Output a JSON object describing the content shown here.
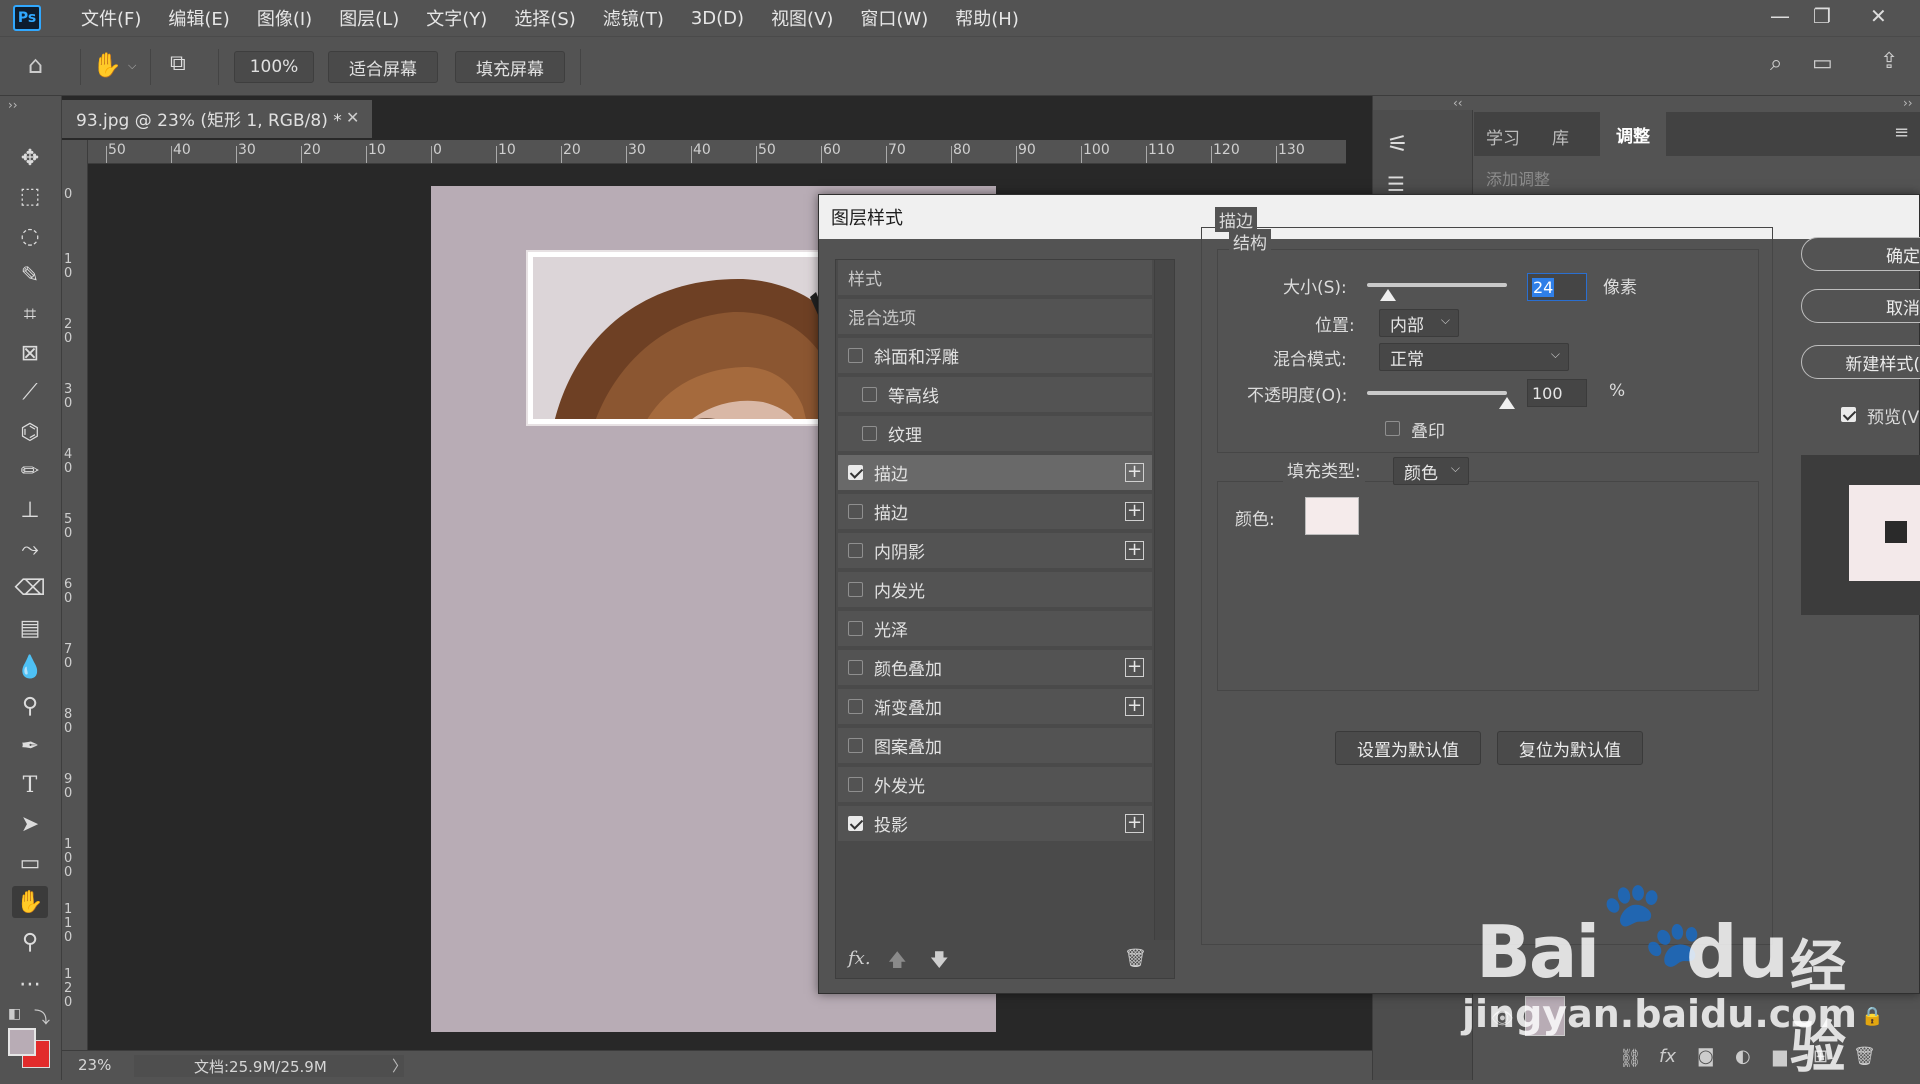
{
  "app": {
    "logo": "Ps"
  },
  "menu": [
    "文件(F)",
    "编辑(E)",
    "图像(I)",
    "图层(L)",
    "文字(Y)",
    "选择(S)",
    "滤镜(T)",
    "3D(D)",
    "视图(V)",
    "窗口(W)",
    "帮助(H)"
  ],
  "options": {
    "zoom": "100%",
    "fit_screen": "适合屏幕",
    "fill_screen": "填充屏幕"
  },
  "document": {
    "tab_title": "93.jpg @ 23% (矩形 1, RGB/8) *",
    "ruler_top": [
      "50",
      "40",
      "30",
      "20",
      "10",
      "0",
      "10",
      "20",
      "30",
      "40",
      "50",
      "60",
      "70",
      "80",
      "90",
      "100",
      "110",
      "120",
      "130"
    ],
    "ruler_left": [
      "0",
      "1 0",
      "2 0",
      "3 0",
      "4 0",
      "5 0",
      "6 0",
      "7 0",
      "8 0",
      "9 0",
      "1 0 0",
      "1 1 0",
      "1 2 0"
    ],
    "zoom": "23%",
    "doc_info": "文档:25.9M/25.9M"
  },
  "right_panel": {
    "tabs": [
      "学习",
      "库",
      "调整"
    ],
    "hint": "添加调整"
  },
  "dialog": {
    "title": "图层样式",
    "styles_header": "样式",
    "blend_options": "混合选项",
    "items": [
      {
        "label": "斜面和浮雕",
        "checked": false,
        "plus": false,
        "indent": false
      },
      {
        "label": "等高线",
        "checked": false,
        "plus": false,
        "indent": true
      },
      {
        "label": "纹理",
        "checked": false,
        "plus": false,
        "indent": true
      },
      {
        "label": "描边",
        "checked": true,
        "plus": true,
        "indent": false,
        "selected": true
      },
      {
        "label": "描边",
        "checked": false,
        "plus": true,
        "indent": false
      },
      {
        "label": "内阴影",
        "checked": false,
        "plus": true,
        "indent": false
      },
      {
        "label": "内发光",
        "checked": false,
        "plus": false,
        "indent": false
      },
      {
        "label": "光泽",
        "checked": false,
        "plus": false,
        "indent": false
      },
      {
        "label": "颜色叠加",
        "checked": false,
        "plus": true,
        "indent": false
      },
      {
        "label": "渐变叠加",
        "checked": false,
        "plus": true,
        "indent": false
      },
      {
        "label": "图案叠加",
        "checked": false,
        "plus": false,
        "indent": false
      },
      {
        "label": "外发光",
        "checked": false,
        "plus": false,
        "indent": false
      },
      {
        "label": "投影",
        "checked": true,
        "plus": true,
        "indent": false
      }
    ],
    "fx_label": "fx.",
    "stroke": {
      "section": "描边",
      "structure": "结构",
      "size_label": "大小(S):",
      "size_value": "24",
      "size_level": 0.15,
      "size_unit": "像素",
      "position_label": "位置:",
      "position_value": "内部",
      "blend_label": "混合模式:",
      "blend_value": "正常",
      "opacity_label": "不透明度(O):",
      "opacity_value": "100",
      "opacity_level": 1.0,
      "opacity_unit": "%",
      "overprint_label": "叠印",
      "fill_type_label": "填充类型:",
      "fill_type_value": "颜色",
      "color_label": "颜色:",
      "color_swatch": "#f5ebeb",
      "set_default": "设置为默认值",
      "reset_default": "复位为默认值"
    },
    "buttons": {
      "ok": "确定",
      "cancel": "取消",
      "new_style": "新建样式(",
      "preview": "预览(V"
    }
  },
  "watermark": {
    "brand": "Bai",
    "brand2": "du",
    "brand_cn": "经验",
    "url": "jingyan.baidu.com"
  }
}
